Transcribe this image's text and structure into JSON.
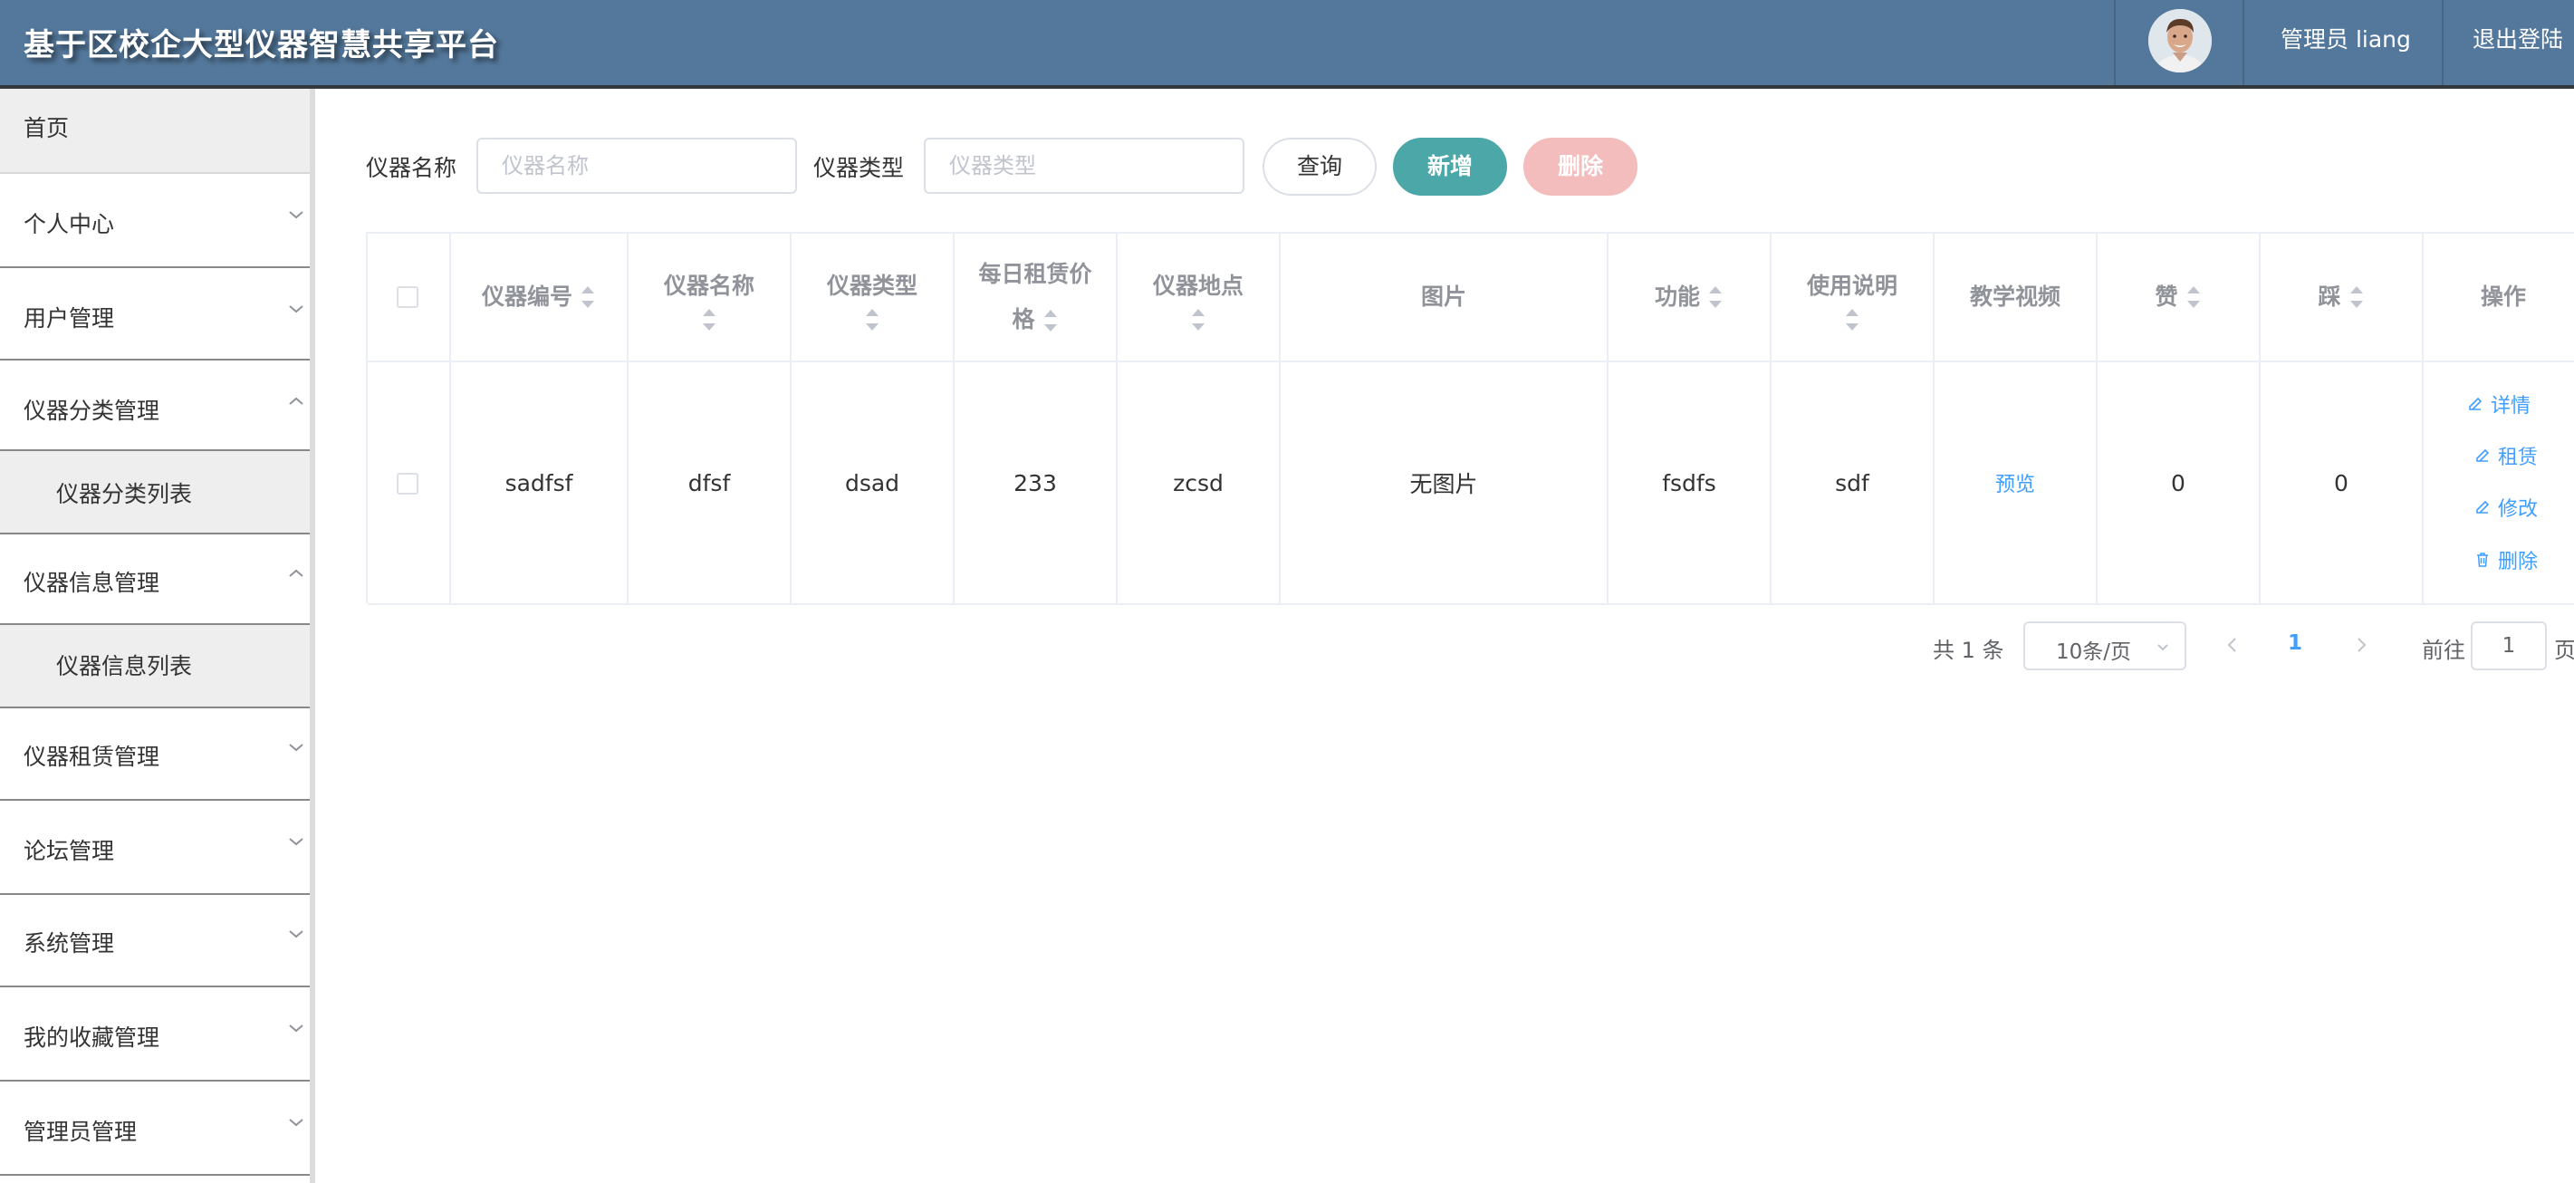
{
  "header": {
    "title": "基于区校企大型仪器智慧共享平台",
    "admin": "管理员 liang",
    "logout": "退出登陆"
  },
  "sidebar": {
    "items": [
      {
        "label": "首页"
      },
      {
        "label": "个人中心"
      },
      {
        "label": "用户管理"
      },
      {
        "label": "仪器分类管理"
      },
      {
        "label": "仪器分类列表"
      },
      {
        "label": "仪器信息管理"
      },
      {
        "label": "仪器信息列表"
      },
      {
        "label": "仪器租赁管理"
      },
      {
        "label": "论坛管理"
      },
      {
        "label": "系统管理"
      },
      {
        "label": "我的收藏管理"
      },
      {
        "label": "管理员管理"
      }
    ]
  },
  "search": {
    "name_label": "仪器名称",
    "name_placeholder": "仪器名称",
    "type_label": "仪器类型",
    "type_placeholder": "仪器类型",
    "query_button": "查询",
    "add_button": "新增",
    "delete_button": "删除"
  },
  "table": {
    "columns": [
      "仪器编号",
      "仪器名称",
      "仪器类型",
      "每日租赁价",
      "格",
      "仪器地点",
      "图片",
      "功能",
      "使用说明",
      "教学视频",
      "赞",
      "踩",
      "操作"
    ],
    "rows": [
      {
        "code": "sadfsf",
        "name": "dfsf",
        "type": "dsad",
        "price": "233",
        "location": "zcsd",
        "image": "无图片",
        "function": "fsdfs",
        "manual": "sdf",
        "video": "预览",
        "likes": "0",
        "dislikes": "0"
      }
    ],
    "actions": [
      "详情",
      "租赁",
      "修改",
      "删除"
    ]
  },
  "pagination": {
    "total": "共 1 条",
    "page_size": "10条/页",
    "current_page": "1",
    "goto_label": "前往",
    "goto_value": "1",
    "page_suffix": "页"
  },
  "colors": {
    "header_bg": "#54789b",
    "primary": "#409eff",
    "add_button": "#4ba7a8",
    "delete_button": "#f4bdbd"
  }
}
